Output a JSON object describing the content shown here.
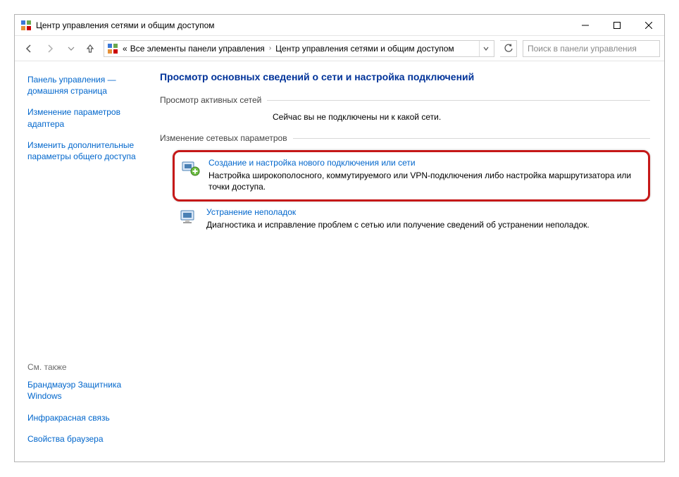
{
  "window": {
    "title": "Центр управления сетями и общим доступом"
  },
  "breadcrumb": {
    "prefix": "«",
    "item1": "Все элементы панели управления",
    "item2": "Центр управления сетями и общим доступом"
  },
  "search": {
    "placeholder": "Поиск в панели управления"
  },
  "sidebar": {
    "links": [
      "Панель управления — домашняя страница",
      "Изменение параметров адаптера",
      "Изменить дополнительные параметры общего доступа"
    ],
    "see_also_heading": "См. также",
    "see_also": [
      "Брандмауэр Защитника Windows",
      "Инфракрасная связь",
      "Свойства браузера"
    ]
  },
  "main": {
    "title": "Просмотр основных сведений о сети и настройка подключений",
    "section_active_label": "Просмотр активных сетей",
    "status_text": "Сейчас вы не подключены ни к какой сети.",
    "section_change_label": "Изменение сетевых параметров",
    "tasks": [
      {
        "title": "Создание и настройка нового подключения или сети",
        "desc": "Настройка широкополосного, коммутируемого или VPN-подключения либо настройка маршрутизатора или точки доступа."
      },
      {
        "title": "Устранение неполадок",
        "desc": "Диагностика и исправление проблем с сетью или получение сведений об устранении неполадок."
      }
    ]
  }
}
